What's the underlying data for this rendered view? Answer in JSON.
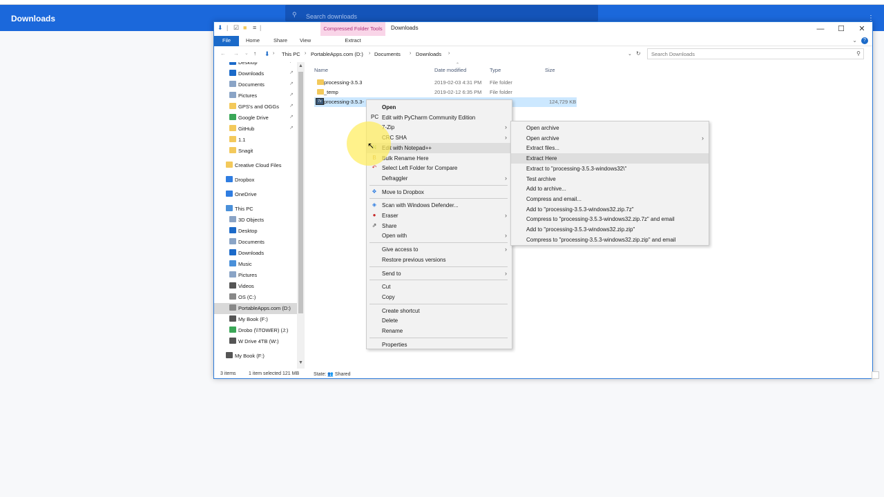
{
  "chrome": {
    "title": "Downloads",
    "search_placeholder": "Search downloads",
    "kebab": "⋮"
  },
  "window": {
    "contextual_tab": "Compressed Folder Tools",
    "title": "Downloads",
    "ribbon_tabs": [
      "File",
      "Home",
      "Share",
      "View",
      "Extract"
    ]
  },
  "address": {
    "crumbs": [
      "This PC",
      "PortableApps.com (D:)",
      "Documents",
      "Downloads"
    ],
    "search_placeholder": "Search Downloads"
  },
  "nav": {
    "items": [
      {
        "label": "Desktop",
        "color": "#1b6ac9",
        "pinned": true
      },
      {
        "label": "Downloads",
        "color": "#1b6ac9",
        "pinned": true
      },
      {
        "label": "Documents",
        "color": "#8aa4c6",
        "pinned": true
      },
      {
        "label": "Pictures",
        "color": "#8aa4c6",
        "pinned": true
      },
      {
        "label": "GPS's and OGGs",
        "color": "#f3c95b",
        "pinned": true
      },
      {
        "label": "Google Drive",
        "color": "#3aa757",
        "pinned": true
      },
      {
        "label": "GitHub",
        "color": "#f3c95b",
        "pinned": true
      },
      {
        "label": "1.1",
        "color": "#f3c95b",
        "pinned": false
      },
      {
        "label": "Snagit",
        "color": "#f3c95b",
        "pinned": false
      },
      {
        "label": "Creative Cloud Files",
        "color": "#f3c95b",
        "pinned": false
      },
      {
        "label": "Dropbox",
        "color": "#2f7de1",
        "pinned": false
      },
      {
        "label": "OneDrive",
        "color": "#2f7de1",
        "pinned": false
      },
      {
        "label": "This PC",
        "color": "#4a90d9",
        "pinned": false
      },
      {
        "label": "3D Objects",
        "color": "#8aa4c6",
        "pinned": false
      },
      {
        "label": "Desktop",
        "color": "#1b6ac9",
        "pinned": false
      },
      {
        "label": "Documents",
        "color": "#8aa4c6",
        "pinned": false
      },
      {
        "label": "Downloads",
        "color": "#1b6ac9",
        "pinned": false
      },
      {
        "label": "Music",
        "color": "#4a90d9",
        "pinned": false
      },
      {
        "label": "Pictures",
        "color": "#8aa4c6",
        "pinned": false
      },
      {
        "label": "Videos",
        "color": "#555555",
        "pinned": false
      },
      {
        "label": "OS (C:)",
        "color": "#888888",
        "pinned": false
      },
      {
        "label": "PortableApps.com (D:)",
        "color": "#888888",
        "pinned": false,
        "selected": true
      },
      {
        "label": "My Book (F:)",
        "color": "#555555",
        "pinned": false
      },
      {
        "label": "Drobo (\\\\TOWER) (J:)",
        "color": "#3aa757",
        "pinned": false
      },
      {
        "label": "W Drive 4TB (W:)",
        "color": "#555555",
        "pinned": false
      },
      {
        "label": "My Book (F:)",
        "color": "#555555",
        "pinned": false
      }
    ]
  },
  "columns": [
    "Name",
    "Date modified",
    "Type",
    "Size"
  ],
  "files": [
    {
      "name": "processing-3.5.3",
      "date": "2019-02-03 4:31 PM",
      "type": "File folder",
      "size": ""
    },
    {
      "name": "_temp",
      "date": "2019-02-12 6:35 PM",
      "type": "File folder",
      "size": ""
    },
    {
      "name": "processing-3.5.3-",
      "date": "",
      "type": "",
      "size": "124,729 KB",
      "selected": true
    }
  ],
  "status": {
    "count": "3 items",
    "selected": "1 item selected  121 MB",
    "state": "State: 👥 Shared"
  },
  "context_menu": {
    "items": [
      {
        "label": "Open",
        "bold": true
      },
      {
        "label": "Edit with PyCharm Community Edition",
        "icon": "PC",
        "icon_color": "#222222"
      },
      {
        "label": "7-Zip",
        "submenu": true
      },
      {
        "label": "CRC SHA",
        "submenu": true
      },
      {
        "label": "Edit with Notepad++",
        "icon": "N",
        "icon_color": "#7bb342",
        "highlight": true
      },
      {
        "label": "Bulk Rename Here",
        "icon": "B",
        "icon_color": "#c79a2b"
      },
      {
        "label": "Select Left Folder for Compare",
        "icon": "↶",
        "icon_color": "#d23a3a"
      },
      {
        "label": "Defraggler",
        "submenu": true
      },
      {
        "label": "Move to Dropbox",
        "icon": "❖",
        "icon_color": "#2f7de1",
        "sep_before": true
      },
      {
        "label": "Scan with Windows Defender...",
        "icon": "◈",
        "icon_color": "#2f7de1",
        "sep_before": true
      },
      {
        "label": "Eraser",
        "icon": "●",
        "icon_color": "#c62828",
        "submenu": true
      },
      {
        "label": "Share",
        "icon": "⇗",
        "icon_color": "#333333"
      },
      {
        "label": "Open with",
        "submenu": true
      },
      {
        "label": "Give access to",
        "submenu": true,
        "sep_before": true
      },
      {
        "label": "Restore previous versions"
      },
      {
        "label": "Send to",
        "submenu": true,
        "sep_before": true
      },
      {
        "label": "Cut",
        "sep_before": true
      },
      {
        "label": "Copy"
      },
      {
        "label": "Create shortcut",
        "sep_before": true
      },
      {
        "label": "Delete"
      },
      {
        "label": "Rename"
      },
      {
        "label": "Properties",
        "sep_before": true
      }
    ]
  },
  "submenu": {
    "items": [
      {
        "label": "Open archive"
      },
      {
        "label": "Open archive",
        "submenu": true
      },
      {
        "label": "Extract files..."
      },
      {
        "label": "Extract Here",
        "highlight": true
      },
      {
        "label": "Extract to \"processing-3.5.3-windows32\\\""
      },
      {
        "label": "Test archive"
      },
      {
        "label": "Add to archive..."
      },
      {
        "label": "Compress and email..."
      },
      {
        "label": "Add to \"processing-3.5.3-windows32.zip.7z\""
      },
      {
        "label": "Compress to \"processing-3.5.3-windows32.zip.7z\" and email"
      },
      {
        "label": "Add to \"processing-3.5.3-windows32.zip.zip\""
      },
      {
        "label": "Compress to \"processing-3.5.3-windows32.zip.zip\" and email"
      }
    ]
  }
}
